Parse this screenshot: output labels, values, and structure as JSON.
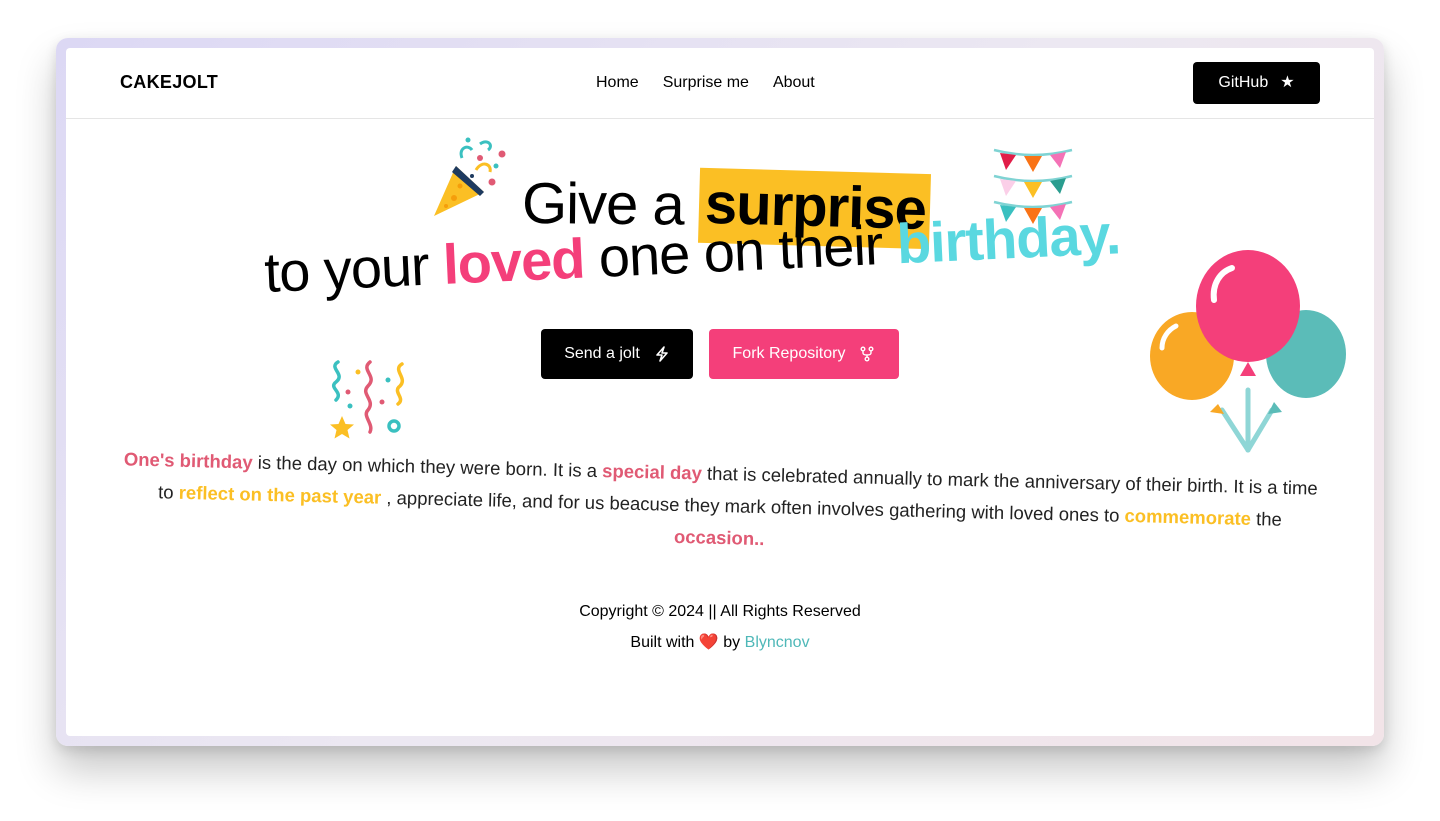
{
  "navbar": {
    "brand": "CAKEJOLT",
    "links": [
      "Home",
      "Surprise me",
      "About"
    ],
    "github_label": "GitHub"
  },
  "hero": {
    "line1_prefix": "Give a",
    "line1_highlight": "surprise",
    "line2_prefix": "to your",
    "line2_loved": "loved",
    "line2_middle": "one on their",
    "line2_birthday": "birthday."
  },
  "actions": {
    "send_jolt": "Send a jolt",
    "fork_repo": "Fork Repository"
  },
  "description": {
    "p1": "One's birthday",
    "p2": " is the day on which they were born. It is a ",
    "p3": "special day",
    "p4": " that is celebrated annually to mark the anniversary of their birth. It is a time to ",
    "p5": "reflect on the past year",
    "p6": " , appreciate life, and for us beacuse they mark often involves gathering with loved ones to ",
    "p7": "commemorate",
    "p8": " the ",
    "p9": "occasion.."
  },
  "footer": {
    "copyright": "Copyright © 2024 || All Rights Reserved",
    "built_prefix": "Built with",
    "heart": "❤️",
    "built_by": "by",
    "author": "Blyncnov"
  },
  "colors": {
    "accent_pink": "#f43f7a",
    "accent_yellow": "#fbbf24",
    "accent_cyan": "#5ad8e0",
    "text_pink": "#e05a74",
    "author_teal": "#4fb8b8"
  },
  "icons": [
    "star-icon",
    "lightning-icon",
    "fork-icon",
    "party-popper-icon",
    "bunting-icon",
    "confetti-icon",
    "balloons-icon"
  ]
}
